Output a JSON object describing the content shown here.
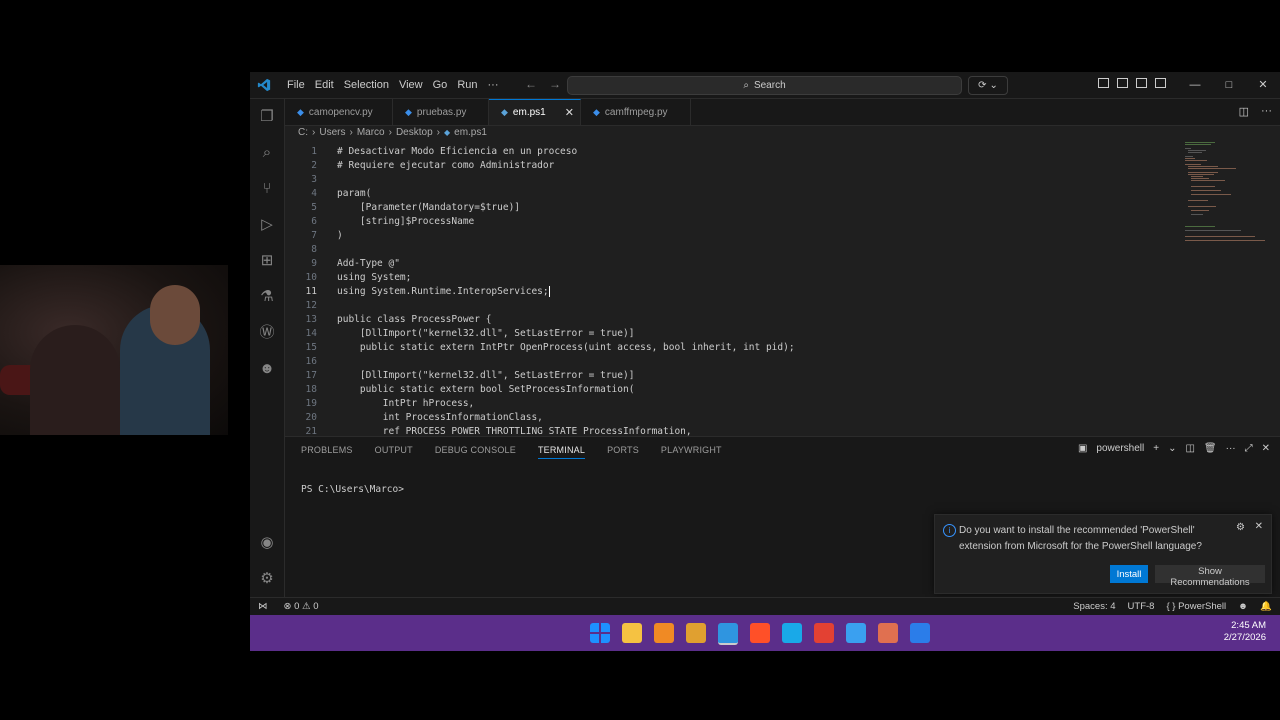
{
  "window": {
    "menu": [
      "File",
      "Edit",
      "Selection",
      "View",
      "Go",
      "Run",
      "···"
    ],
    "search_label": "Search",
    "controls": [
      "—",
      "□",
      "✕"
    ]
  },
  "tabs": [
    {
      "label": "camopencv.py",
      "lang": "python"
    },
    {
      "label": "pruebas.py",
      "lang": "python"
    },
    {
      "label": "em.ps1",
      "lang": "powershell",
      "active": true
    },
    {
      "label": "camffmpeg.py",
      "lang": "python"
    }
  ],
  "breadcrumb": [
    "C:",
    "Users",
    "Marco",
    "Desktop",
    "em.ps1"
  ],
  "editor": {
    "current_line": 11,
    "lines": [
      {
        "n": "1",
        "text": "# Desactivar Modo Eficiencia en un proceso"
      },
      {
        "n": "2",
        "text": "# Requiere ejecutar como Administrador"
      },
      {
        "n": "3",
        "text": ""
      },
      {
        "n": "4",
        "text": "param("
      },
      {
        "n": "5",
        "text": "    [Parameter(Mandatory=$true)]"
      },
      {
        "n": "6",
        "text": "    [string]$ProcessName"
      },
      {
        "n": "7",
        "text": ")"
      },
      {
        "n": "8",
        "text": ""
      },
      {
        "n": "9",
        "text": "Add-Type @\""
      },
      {
        "n": "10",
        "text": "using System;"
      },
      {
        "n": "11",
        "text": "using System.Runtime.InteropServices;"
      },
      {
        "n": "12",
        "text": ""
      },
      {
        "n": "13",
        "text": "public class ProcessPower {"
      },
      {
        "n": "14",
        "text": "    [DllImport(\"kernel32.dll\", SetLastError = true)]"
      },
      {
        "n": "15",
        "text": "    public static extern IntPtr OpenProcess(uint access, bool inherit, int pid);"
      },
      {
        "n": "16",
        "text": ""
      },
      {
        "n": "17",
        "text": "    [DllImport(\"kernel32.dll\", SetLastError = true)]"
      },
      {
        "n": "18",
        "text": "    public static extern bool SetProcessInformation("
      },
      {
        "n": "19",
        "text": "        IntPtr hProcess,"
      },
      {
        "n": "20",
        "text": "        int ProcessInformationClass,"
      },
      {
        "n": "21",
        "text": "        ref PROCESS_POWER_THROTTLING_STATE ProcessInformation,"
      }
    ]
  },
  "panel": {
    "tabs": [
      "PROBLEMS",
      "OUTPUT",
      "DEBUG CONSOLE",
      "TERMINAL",
      "PORTS",
      "PLAYWRIGHT"
    ],
    "active_tab": "TERMINAL",
    "terminal_name": "powershell",
    "prompt": "PS C:\\Users\\Marco>"
  },
  "notification": {
    "message": "Do you want to install the recommended 'PowerShell' extension from Microsoft for the PowerShell language?",
    "install_label": "Install",
    "recommendations_label": "Show Recommendations"
  },
  "statusbar": {
    "errors": "0",
    "warnings": "0",
    "spaces": "Spaces: 4",
    "encoding": "UTF-8",
    "language": "PowerShell"
  },
  "taskbar": {
    "time": "2:45 AM",
    "date": "2/27/2026",
    "apps": [
      "start-icon",
      "file-explorer-icon",
      "sublime-icon",
      "app-icon",
      "vscode-icon",
      "brave-icon",
      "edge-icon",
      "chrome-icon",
      "photos-icon",
      "claude-icon",
      "terminal-icon"
    ],
    "colors": [
      "#1e90ff",
      "#f5c242",
      "#f08a24",
      "#e0a030",
      "#2f95e0",
      "#ff5028",
      "#19a9e8",
      "#e34133",
      "#3aa0f0",
      "#e07050",
      "#2b7de9"
    ]
  },
  "colors": {
    "accent": "#0078d4",
    "taskbar": "#5b2e8a",
    "editor_bg": "#1f1f1f"
  }
}
